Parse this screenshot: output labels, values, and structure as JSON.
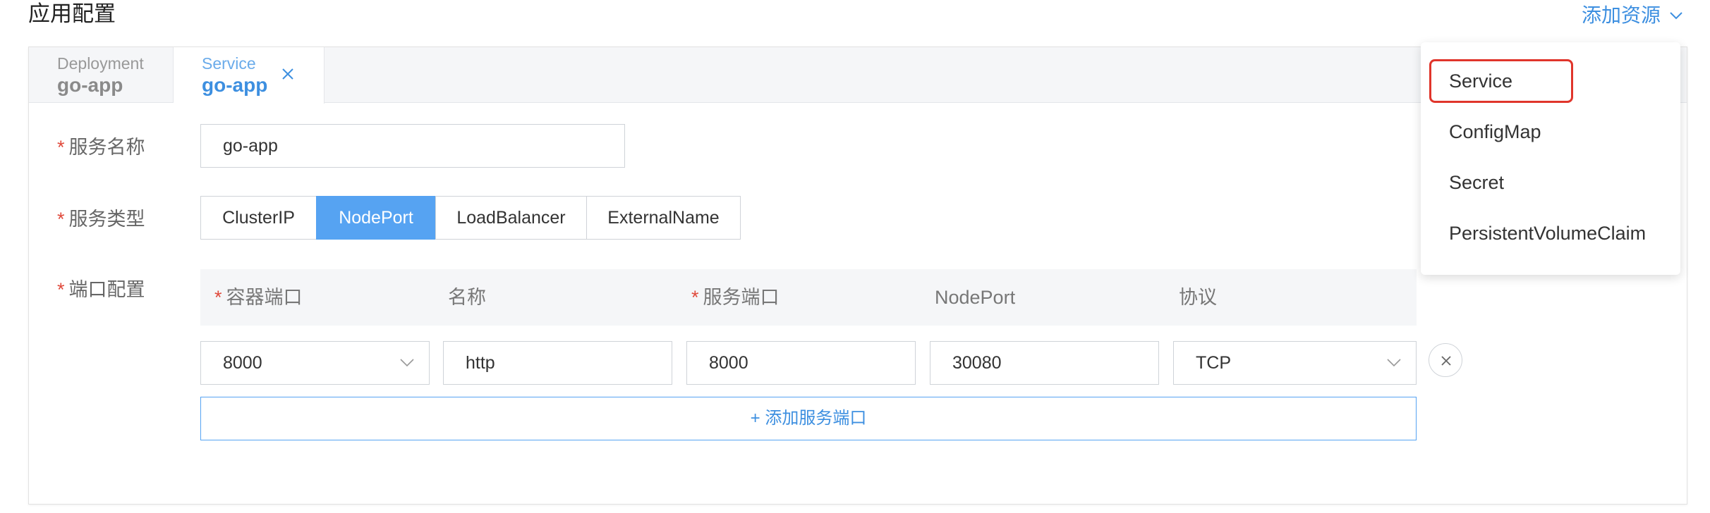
{
  "page": {
    "title": "应用配置"
  },
  "add_resource": {
    "label": "添加资源"
  },
  "tabs": [
    {
      "kind": "Deployment",
      "name": "go-app",
      "active": false
    },
    {
      "kind": "Service",
      "name": "go-app",
      "active": true
    }
  ],
  "form": {
    "service_name": {
      "label": "服务名称",
      "required_mark": "*",
      "value": "go-app"
    },
    "service_type": {
      "label": "服务类型",
      "required_mark": "*",
      "options": [
        "ClusterIP",
        "NodePort",
        "LoadBalancer",
        "ExternalName"
      ],
      "selected": "NodePort"
    },
    "ports": {
      "label": "端口配置",
      "required_mark": "*",
      "headers": [
        {
          "label": "容器端口",
          "required": true
        },
        {
          "label": "名称",
          "required": false
        },
        {
          "label": "服务端口",
          "required": true
        },
        {
          "label": "NodePort",
          "required": false
        },
        {
          "label": "协议",
          "required": false
        }
      ],
      "rows": [
        {
          "container_port": "8000",
          "name": "http",
          "service_port": "8000",
          "node_port": "30080",
          "protocol": "TCP"
        }
      ],
      "add_button": "+ 添加服务端口"
    }
  },
  "dropdown": {
    "items": [
      "Service",
      "ConfigMap",
      "Secret",
      "PersistentVolumeClaim"
    ],
    "highlighted": "Service"
  },
  "colors": {
    "accent": "#56a3f2",
    "link": "#3d8fe0",
    "required": "#e04a3c",
    "highlight": "#e0352b"
  }
}
